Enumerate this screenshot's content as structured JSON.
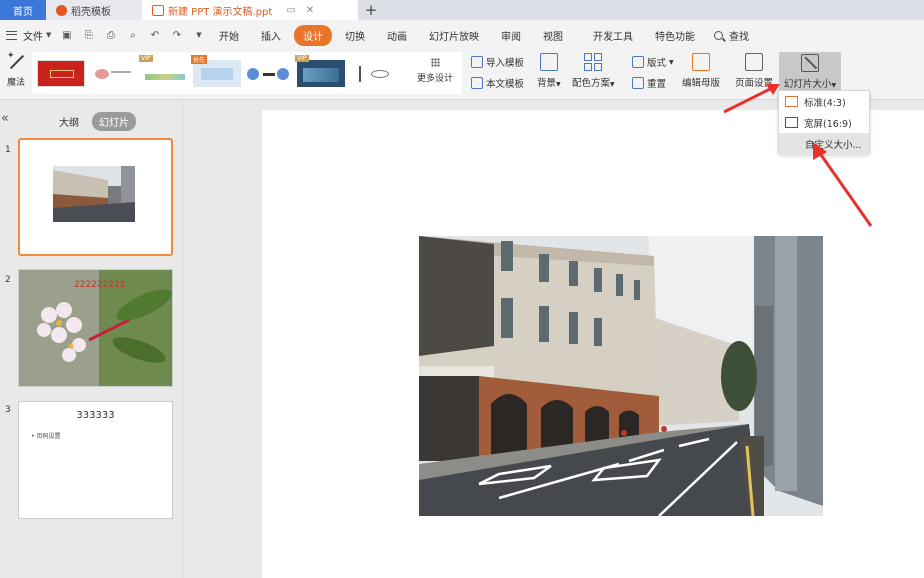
{
  "tabs": {
    "home": "首页",
    "template": "稻壳模板",
    "document": "新建 PPT 演示文稿.ppt",
    "add": "+"
  },
  "menubar": {
    "file": "文件",
    "items": [
      "开始",
      "插入",
      "设计",
      "切换",
      "动画",
      "幻灯片放映",
      "审阅",
      "视图",
      "开发工具",
      "特色功能"
    ],
    "active_item": "设计",
    "search": "查找"
  },
  "ribbon": {
    "magic": "魔法",
    "more_design": "更多设计",
    "import_template": "导入模板",
    "text_template": "本文模板",
    "background": "背景",
    "color_scheme": "配色方案",
    "layout": "版式",
    "reset": "重置",
    "edit_master": "编辑母版",
    "page_setup": "页面设置",
    "slide_size": "幻灯片大小",
    "thumb_badges": [
      "VIP",
      "抢先",
      "VIP"
    ]
  },
  "dropdown": {
    "standard": "标准(4:3)",
    "widescreen": "宽屏(16:9)",
    "custom": "自定义大小..."
  },
  "pane": {
    "outline": "大纲",
    "slides": "幻灯片"
  },
  "slides": [
    {
      "number": "1"
    },
    {
      "number": "2",
      "text": "222222222"
    },
    {
      "number": "3",
      "title": "333333",
      "bullet": "• 页码设置"
    }
  ],
  "colors": {
    "accent": "#e8752b",
    "home_tab": "#3a77d8",
    "arrow": "#e8312a"
  }
}
